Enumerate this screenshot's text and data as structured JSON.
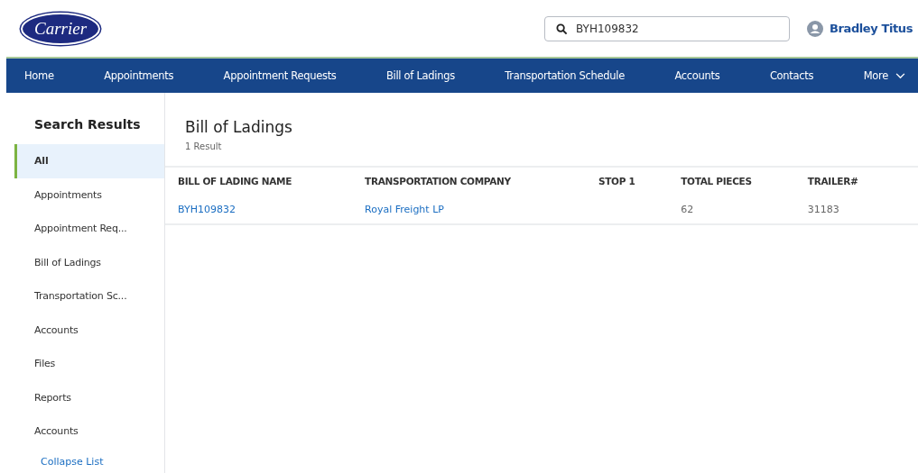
{
  "logo": "Carrier",
  "search": {
    "value": "BYH109832"
  },
  "user": {
    "name": "Bradley Titus"
  },
  "nav": [
    {
      "label": "Home"
    },
    {
      "label": "Appointments"
    },
    {
      "label": "Appointment Requests"
    },
    {
      "label": "Bill of Ladings"
    },
    {
      "label": "Transportation Schedule"
    },
    {
      "label": "Accounts"
    },
    {
      "label": "Contacts"
    },
    {
      "label": "More",
      "kind": "menu"
    }
  ],
  "sidebar": {
    "title": "Search Results",
    "items": [
      {
        "label": "All",
        "selected": true
      },
      {
        "label": "Appointments",
        "selected": false
      },
      {
        "label": "Appointment Req...",
        "selected": false
      },
      {
        "label": "Bill of Ladings",
        "selected": false
      },
      {
        "label": "Transportation Sc...",
        "selected": false
      },
      {
        "label": "Accounts",
        "selected": false
      },
      {
        "label": "Files",
        "selected": false
      },
      {
        "label": "Reports",
        "selected": false
      },
      {
        "label": "Accounts",
        "selected": false
      }
    ],
    "collapse": "Collapse List"
  },
  "results": {
    "title": "Bill of Ladings",
    "count": "1 Result",
    "table": {
      "columns": [
        "BILL OF LADING NAME",
        "TRANSPORTATION COMPANY",
        "STOP 1",
        "TOTAL PIECES",
        "TRAILER#"
      ],
      "rows": [
        [
          {
            "text": "BYH109832",
            "kind": "link"
          },
          {
            "text": "Royal Freight LP",
            "kind": "link"
          },
          {
            "text": "",
            "kind": "text"
          },
          {
            "text": "62",
            "kind": "text"
          },
          {
            "text": "31183",
            "kind": "text"
          }
        ]
      ]
    }
  }
}
